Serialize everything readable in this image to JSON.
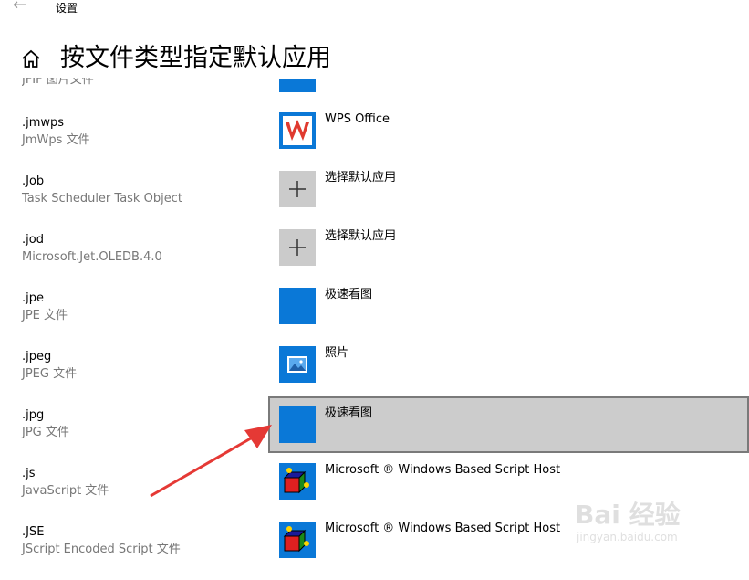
{
  "window": {
    "back_icon": "arrow-left-icon",
    "title": "设置"
  },
  "header": {
    "home_icon": "home-icon",
    "page_title": "按文件类型指定默认应用"
  },
  "partial_row": {
    "desc": "JFIF 图片文件"
  },
  "rows": [
    {
      "ext": ".jmwps",
      "desc": "JmWps 文件",
      "app": "WPS Office",
      "icon": "wps-office-icon"
    },
    {
      "ext": ".Job",
      "desc": "Task Scheduler Task Object",
      "app": "选择默认应用",
      "icon": "plus-icon"
    },
    {
      "ext": ".jod",
      "desc": "Microsoft.Jet.OLEDB.4.0",
      "app": "选择默认应用",
      "icon": "plus-icon"
    },
    {
      "ext": ".jpe",
      "desc": "JPE 文件",
      "app": "极速看图",
      "icon": "jisu-viewer-icon"
    },
    {
      "ext": ".jpeg",
      "desc": "JPEG 文件",
      "app": "照片",
      "icon": "photos-icon"
    },
    {
      "ext": ".jpg",
      "desc": "JPG 文件",
      "app": "极速看图",
      "icon": "jisu-viewer-icon"
    },
    {
      "ext": ".js",
      "desc": "JavaScript 文件",
      "app": "Microsoft ® Windows Based Script Host",
      "icon": "script-host-icon"
    },
    {
      "ext": ".JSE",
      "desc": "JScript Encoded Script 文件",
      "app": "Microsoft ® Windows Based Script Host",
      "icon": "script-host-icon"
    }
  ],
  "annotation": {
    "arrow_icon": "red-arrow-icon"
  },
  "watermark": {
    "brand": "Bai 经验",
    "url": "jingyan.baidu.com"
  },
  "colors": {
    "accent": "#0a78d7",
    "selected_bg": "#cccccc",
    "arrow": "#e53935"
  }
}
